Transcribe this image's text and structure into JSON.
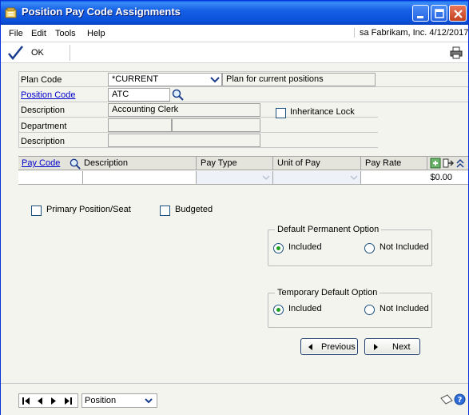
{
  "window": {
    "title": "Position Pay Code Assignments",
    "controls": {
      "minimize": "minimize-icon",
      "maximize": "maximize-icon",
      "close": "close-icon"
    }
  },
  "menu": {
    "items": [
      "File",
      "Edit",
      "Tools",
      "Help"
    ],
    "company_info": "sa  Fabrikam, Inc.  4/12/2017"
  },
  "toolbar": {
    "ok_label": "OK"
  },
  "form": {
    "plan_code_label": "Plan Code",
    "plan_code_value": "*CURRENT",
    "plan_code_description": "Plan for current positions",
    "position_code_label": "Position Code",
    "position_code_value": "ATC",
    "description_label": "Description",
    "description_value": "Accounting Clerk",
    "inheritance_lock_label": "Inheritance Lock",
    "department_label": "Department",
    "department_description_label": "Description"
  },
  "grid": {
    "columns": [
      "Pay Code",
      "Description",
      "Pay Type",
      "Unit of Pay",
      "Pay Rate"
    ],
    "rows": [
      {
        "pay_code": "",
        "description": "",
        "pay_type": "",
        "unit_of_pay": "",
        "pay_rate": "$0.00"
      }
    ]
  },
  "options": {
    "primary_position_label": "Primary Position/Seat",
    "budgeted_label": "Budgeted",
    "default_permanent": {
      "title": "Default Permanent Option",
      "included": "Included",
      "not_included": "Not Included",
      "selected": "Included"
    },
    "temporary_default": {
      "title": "Temporary Default Option",
      "included": "Included",
      "not_included": "Not Included",
      "selected": "Included"
    }
  },
  "navigation": {
    "previous": "Previous",
    "next": "Next"
  },
  "statusbar": {
    "sort_option": "Position"
  },
  "colors": {
    "titlebar": "#0a4fd8",
    "link": "#0000cc",
    "radio_selected": "#21a121"
  }
}
